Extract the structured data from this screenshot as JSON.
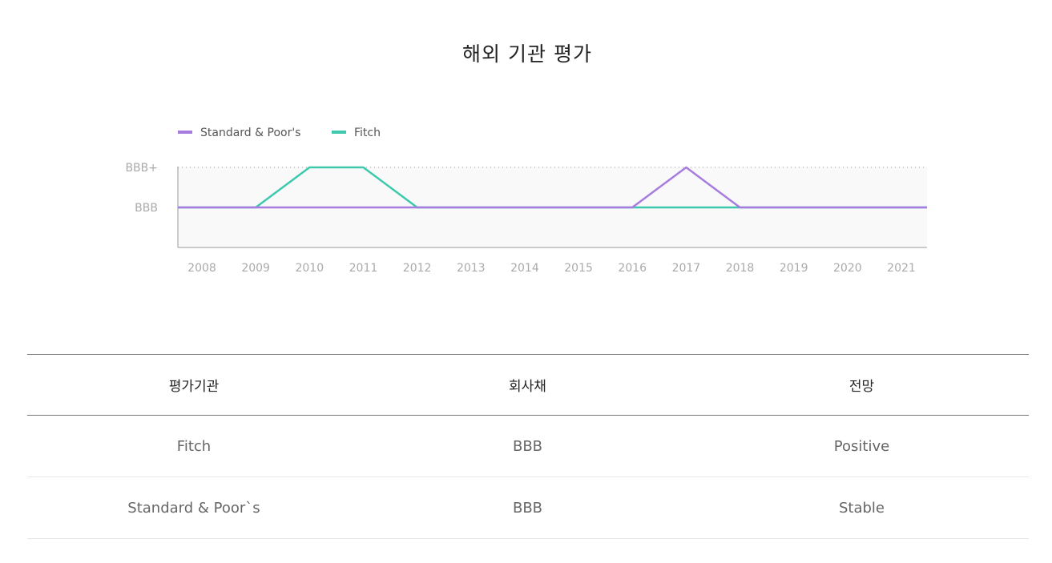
{
  "page": {
    "title": "해외 기관 평가"
  },
  "chart_data": {
    "type": "line",
    "title": "",
    "x": [
      "2008",
      "2009",
      "2010",
      "2011",
      "2012",
      "2013",
      "2014",
      "2015",
      "2016",
      "2017",
      "2018",
      "2019",
      "2020",
      "2021"
    ],
    "y_categories": [
      "BBB",
      "BBB+"
    ],
    "series": [
      {
        "name": "Standard & Poor's",
        "color": "#a77be0",
        "values": [
          "BBB",
          "BBB",
          "BBB",
          "BBB",
          "BBB",
          "BBB",
          "BBB",
          "BBB",
          "BBB",
          "BBB+",
          "BBB",
          "BBB",
          "BBB",
          "BBB"
        ]
      },
      {
        "name": "Fitch",
        "color": "#3ec9ae",
        "values": [
          "BBB",
          "BBB",
          "BBB+",
          "BBB+",
          "BBB",
          "BBB",
          "BBB",
          "BBB",
          "BBB",
          "BBB",
          "BBB",
          "BBB",
          "BBB",
          "BBB"
        ]
      }
    ],
    "legend_position": "top-left",
    "grid": "dotted line at BBB+",
    "background": "#f9f9f9"
  },
  "table": {
    "headers": [
      "평가기관",
      "회사채",
      "전망"
    ],
    "rows": [
      [
        "Fitch",
        "BBB",
        "Positive"
      ],
      [
        "Standard & Poor`s",
        "BBB",
        "Stable"
      ]
    ]
  }
}
